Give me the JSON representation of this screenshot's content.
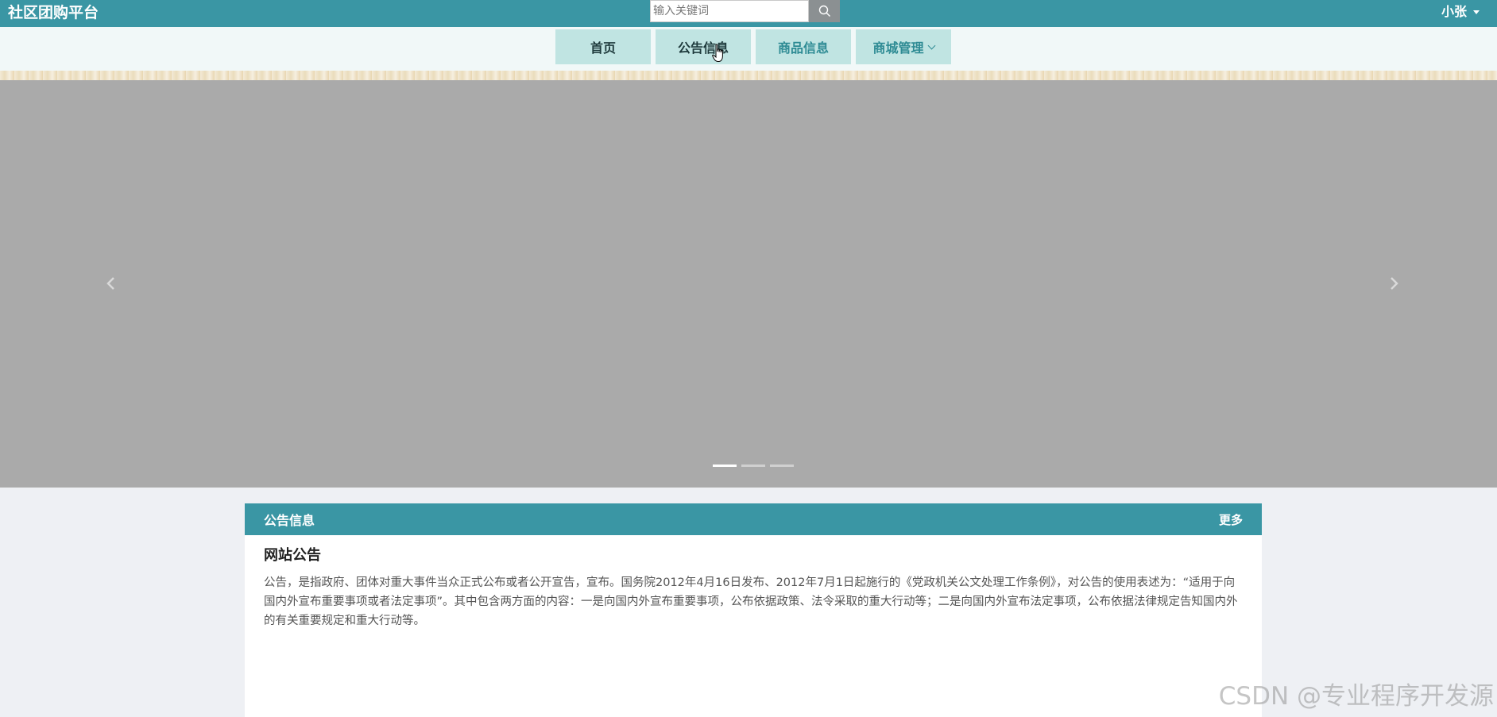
{
  "header": {
    "brand": "社区团购平台",
    "search": {
      "placeholder": "输入关键词",
      "value": ""
    },
    "user": {
      "name": "小张"
    }
  },
  "nav": {
    "items": [
      {
        "label": "首页"
      },
      {
        "label": "公告信息"
      },
      {
        "label": "商品信息"
      },
      {
        "label": "商城管理"
      }
    ],
    "hovered": "公告信息"
  },
  "carousel": {
    "slide_count": 3,
    "active_index": 0
  },
  "notice_section": {
    "title": "公告信息",
    "more_label": "更多",
    "announcement": {
      "title": "网站公告",
      "body": "公告，是指政府、团体对重大事件当众正式公布或者公开宣告，宣布。国务院2012年4月16日发布、2012年7月1日起施行的《党政机关公文处理工作条例》，对公告的使用表述为：“适用于向国内外宣布重要事项或者法定事项”。其中包含两方面的内容：一是向国内外宣布重要事项，公布依据政策、法令采取的重大行动等；二是向国内外宣布法定事项，公布依据法律规定告知国内外的有关重要规定和重大行动等。"
    }
  },
  "watermark": "CSDN @专业程序开发源",
  "colors": {
    "primary": "#3a96a4",
    "nav_bg": "#c0e4e2",
    "carousel_bg": "#aaaaaa",
    "page_bg": "#eef0f4"
  }
}
